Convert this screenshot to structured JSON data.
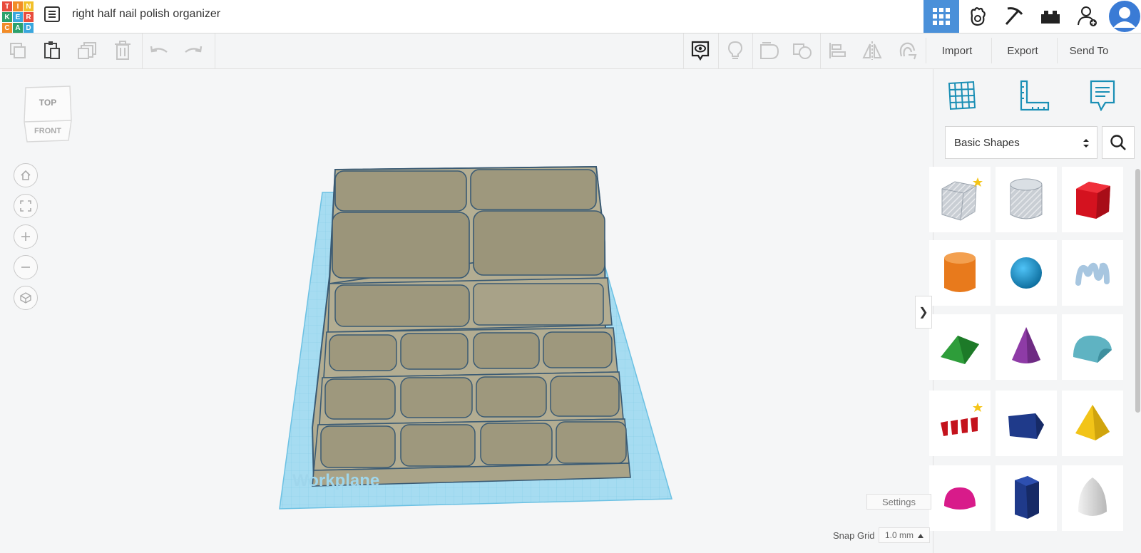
{
  "app": {
    "logo_letters": [
      "T",
      "I",
      "N",
      "K",
      "E",
      "R",
      "C",
      "A",
      "D"
    ],
    "logo_colors": [
      "#e84c3d",
      "#f28c28",
      "#f2c029",
      "#2ca16c",
      "#3aa7de",
      "#e84c3d",
      "#f28c28",
      "#2ca16c",
      "#3aa7de"
    ],
    "project_title": "right half nail polish organizer"
  },
  "topbar": {
    "icons": [
      "grid-icon",
      "gallery-icon",
      "pickaxe-icon",
      "bricks-icon",
      "add-user-icon",
      "user-avatar"
    ]
  },
  "toolbar": {
    "tools": [
      "copy-icon",
      "paste-icon",
      "duplicate-icon",
      "delete-icon",
      "undo-icon",
      "redo-icon"
    ],
    "view_tools": [
      "show-all-icon",
      "light-icon",
      "shape-solid-icon",
      "shape-hole-icon",
      "align-icon",
      "mirror-icon",
      "magnet-icon"
    ],
    "import_label": "Import",
    "export_label": "Export",
    "sendto_label": "Send To"
  },
  "viewcube": {
    "top_label": "TOP",
    "front_label": "FRONT"
  },
  "workplane": {
    "label": "Workplane"
  },
  "sidebar": {
    "category": "Basic Shapes",
    "shapes": [
      "box-hole",
      "cylinder-hole",
      "box",
      "cylinder",
      "sphere",
      "scribble",
      "roof",
      "cone",
      "round-roof",
      "text",
      "wedge",
      "pyramid",
      "half-sphere",
      "polygon",
      "paraboloid"
    ]
  },
  "footer": {
    "settings_label": "Settings",
    "snap_grid_label": "Snap Grid",
    "snap_grid_value": "1.0 mm"
  },
  "colors": {
    "accent": "#4a90d9",
    "model": "#b3ad92",
    "model_edge": "#3a5a73",
    "workplane": "#8fd3ee"
  }
}
